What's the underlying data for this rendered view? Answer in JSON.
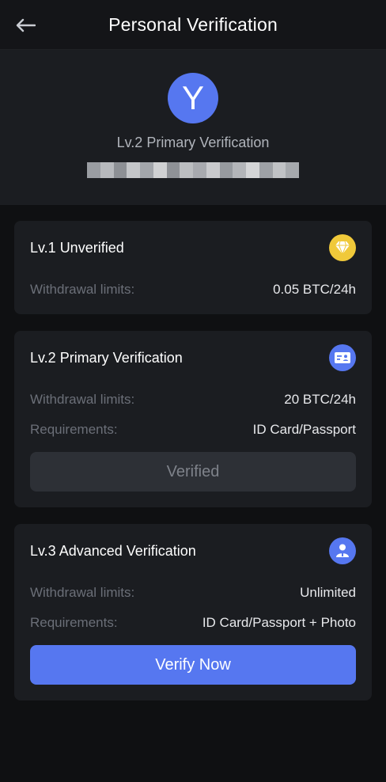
{
  "header": {
    "title": "Personal Verification",
    "back_icon": "arrow-left-icon"
  },
  "profile": {
    "avatar_letter": "Y",
    "avatar_color": "#5677f0",
    "level_label": "Lv.2 Primary Verification"
  },
  "levels": [
    {
      "title": "Lv.1 Unverified",
      "icon": "diamond-icon",
      "icon_color": "#f0c93a",
      "rows": [
        {
          "label": "Withdrawal limits:",
          "value": "0.05 BTC/24h"
        }
      ]
    },
    {
      "title": "Lv.2 Primary Verification",
      "icon": "id-card-icon",
      "icon_color": "#5677f0",
      "rows": [
        {
          "label": "Withdrawal limits:",
          "value": "20 BTC/24h"
        },
        {
          "label": "Requirements:",
          "value": "ID Card/Passport"
        }
      ],
      "button": {
        "label": "Verified",
        "state": "disabled"
      }
    },
    {
      "title": "Lv.3 Advanced Verification",
      "icon": "user-badge-icon",
      "icon_color": "#5677f0",
      "rows": [
        {
          "label": "Withdrawal limits:",
          "value": "Unlimited"
        },
        {
          "label": "Requirements:",
          "value": "ID Card/Passport + Photo"
        }
      ],
      "button": {
        "label": "Verify Now",
        "state": "enabled"
      }
    }
  ],
  "colors": {
    "accent": "#5677f0",
    "background": "#0f1012",
    "card": "#1b1d21",
    "muted_text": "#6b6f78"
  }
}
